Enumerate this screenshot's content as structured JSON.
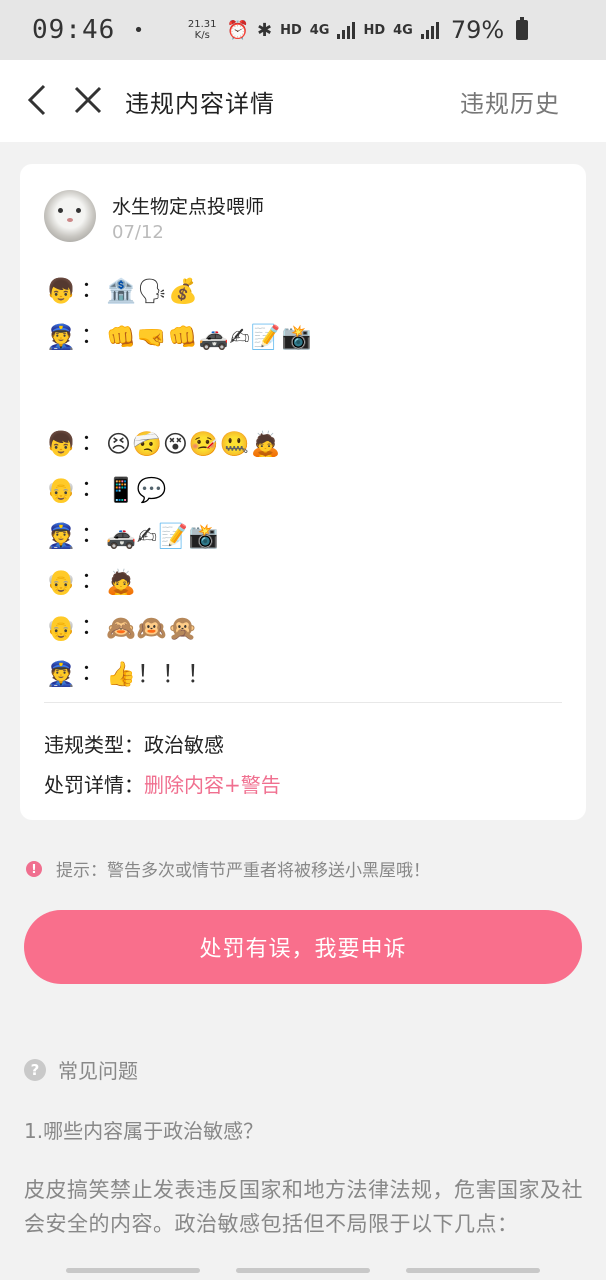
{
  "status_bar": {
    "time": "09:46",
    "dot": "•",
    "net_speed_value": "21.31",
    "net_speed_unit": "K/s",
    "hd1": "HD",
    "net1": "4G",
    "hd2": "HD",
    "net2": "4G",
    "battery": "79%"
  },
  "nav": {
    "title": "违规内容详情",
    "history": "违规历史"
  },
  "post": {
    "author": "水生物定点投喂师",
    "date": "07/12",
    "lines": [
      {
        "speaker": "👦",
        "msg": "🏦🗣💰"
      },
      {
        "speaker": "👮",
        "msg": "👊🤜👊🚓✍📝📸"
      },
      {
        "speaker": "",
        "msg": ""
      },
      {
        "speaker": "👦",
        "msg": "😣🤕😵🤒🤐🙇"
      },
      {
        "speaker": "👴",
        "msg": "📱💬"
      },
      {
        "speaker": "👮",
        "msg": "🚓✍📝📸"
      },
      {
        "speaker": "👴",
        "msg": "🙇"
      },
      {
        "speaker": "👴",
        "msg": "🙈🙉🙊"
      },
      {
        "speaker": "👮",
        "msg": "👍！！！"
      }
    ],
    "colon": "："
  },
  "violation": {
    "type_label": "违规类型：",
    "type_value": "政治敏感",
    "penalty_label": "处罚详情：",
    "penalty_value": "删除内容+警告"
  },
  "tip": {
    "text": "提示：警告多次或情节严重者将被移送小黑屋哦！"
  },
  "appeal_button": "处罚有误，我要申诉",
  "faq": {
    "title": "常见问题",
    "question": "1.哪些内容属于政治敏感？",
    "answer": "皮皮搞笑禁止发表违反国家和地方法律法规，危害国家及社会安全的内容。政治敏感包括但不局限于以下几点："
  },
  "colors": {
    "accent": "#f96f8c",
    "penalty_text": "#f06f8f"
  }
}
